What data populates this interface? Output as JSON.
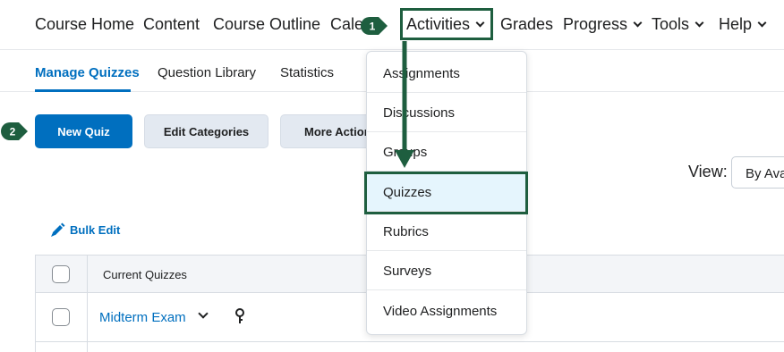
{
  "topnav": {
    "items": [
      {
        "label": "Course Home",
        "dropdown": false
      },
      {
        "label": "Content",
        "dropdown": false
      },
      {
        "label": "Course Outline",
        "dropdown": false
      },
      {
        "label": "Cale",
        "dropdown": false
      },
      {
        "label": "Activities",
        "dropdown": true
      },
      {
        "label": "Grades",
        "dropdown": false
      },
      {
        "label": "Progress",
        "dropdown": true
      },
      {
        "label": "Tools",
        "dropdown": true
      },
      {
        "label": "Help",
        "dropdown": true
      }
    ]
  },
  "tabs": [
    {
      "label": "Manage Quizzes",
      "active": true
    },
    {
      "label": "Question Library",
      "active": false
    },
    {
      "label": "Statistics",
      "active": false
    }
  ],
  "toolbar": {
    "new_quiz": "New Quiz",
    "edit_categories": "Edit Categories",
    "more_actions": "More Action"
  },
  "view": {
    "label": "View:",
    "selected": "By Ava"
  },
  "bulk_edit": "Bulk Edit",
  "table": {
    "header": "Current Quizzes",
    "rows": [
      {
        "name": "Midterm Exam"
      }
    ]
  },
  "dropdown": {
    "items": [
      {
        "label": "Assignments"
      },
      {
        "label": "Discussions"
      },
      {
        "label": "Groups"
      },
      {
        "label": "Quizzes",
        "selected": true
      },
      {
        "label": "Rubrics"
      },
      {
        "label": "Surveys"
      },
      {
        "label": "Video Assignments"
      }
    ]
  },
  "steps": {
    "step1": "1",
    "step2": "2"
  },
  "colors": {
    "brand_blue": "#006fbf",
    "callout_green": "#1e5e3f",
    "selected_bg": "#e5f5fd"
  }
}
